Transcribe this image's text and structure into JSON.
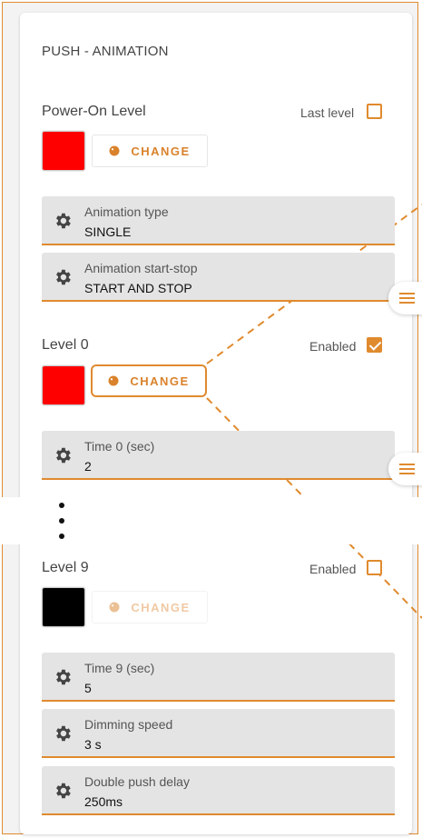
{
  "section": {
    "title": "PUSH - ANIMATION"
  },
  "power_on": {
    "title": "Power-On Level",
    "last_level_label": "Last level",
    "last_level_checked": false,
    "color": "#ff0000",
    "change_label": "CHANGE",
    "fields": [
      {
        "label": "Animation type",
        "value": "SINGLE"
      },
      {
        "label": "Animation start-stop",
        "value": "START AND STOP"
      }
    ]
  },
  "level0": {
    "title": "Level 0",
    "enabled_label": "Enabled",
    "enabled": true,
    "color": "#ff0000",
    "change_label": "CHANGE",
    "field": {
      "label": "Time 0 (sec)",
      "value": "2"
    }
  },
  "level9": {
    "title": "Level 9",
    "enabled_label": "Enabled",
    "enabled": false,
    "color": "#000000",
    "change_label": "CHANGE",
    "fields": [
      {
        "label": "Time 9 (sec)",
        "value": "5"
      },
      {
        "label": "Dimming speed",
        "value": "3 s"
      },
      {
        "label": "Double push delay",
        "value": "250ms"
      }
    ]
  },
  "icons": {
    "settings": "gear-icon",
    "palette": "palette-icon",
    "menu": "hamburger-menu-icon",
    "more": "vertical-ellipsis-icon"
  },
  "colors": {
    "accent": "#e08a2e",
    "field_bg": "#e4e4e4"
  }
}
